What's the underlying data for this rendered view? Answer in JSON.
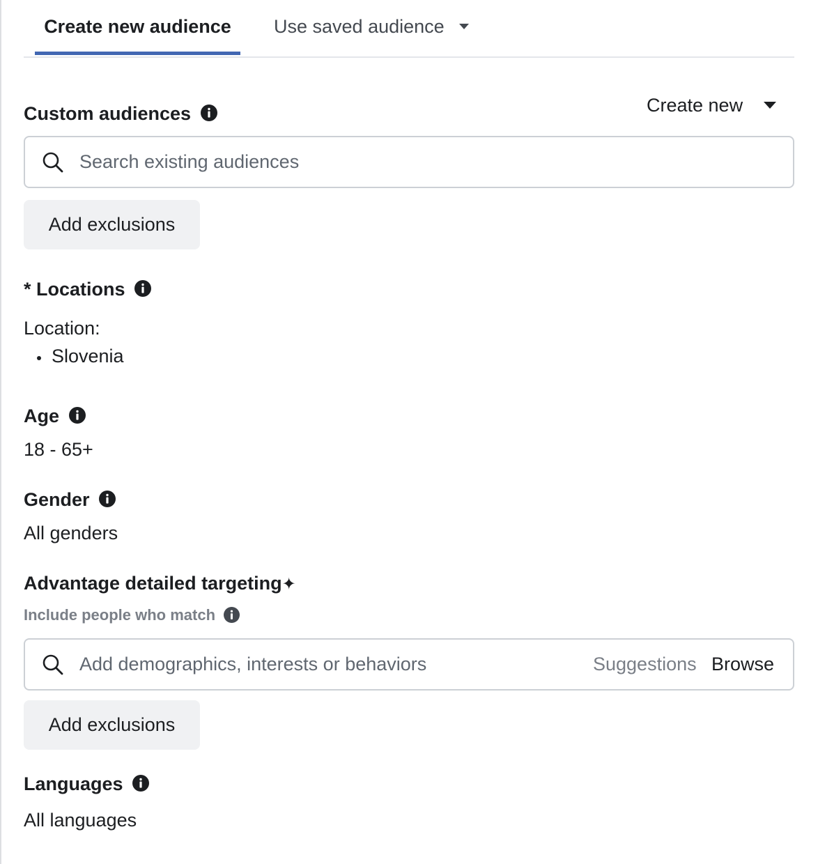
{
  "tabs": {
    "create_new": "Create new audience",
    "use_saved": "Use saved audience"
  },
  "custom_audiences": {
    "title": "Custom audiences",
    "create_new_label": "Create new",
    "search_placeholder": "Search existing audiences",
    "add_exclusions_label": "Add exclusions"
  },
  "locations": {
    "required_mark": "*",
    "title": "Locations",
    "label": "Location:",
    "items": [
      "Slovenia"
    ]
  },
  "age": {
    "title": "Age",
    "value": "18 - 65+"
  },
  "gender": {
    "title": "Gender",
    "value": "All genders"
  },
  "detailed_targeting": {
    "title": "Advantage detailed targeting",
    "sparkle": "✦",
    "include_label": "Include people who match",
    "search_placeholder": "Add demographics, interests or behaviors",
    "suggestions_label": "Suggestions",
    "browse_label": "Browse",
    "add_exclusions_label": "Add exclusions"
  },
  "languages": {
    "title": "Languages",
    "value": "All languages"
  },
  "colors": {
    "accent": "#4267b2",
    "text": "#1c1e21",
    "muted": "#606770",
    "button_bg": "#f0f1f3",
    "border": "#ccd0d5"
  },
  "icons": {
    "info": "info-icon",
    "search": "search-icon",
    "caret": "caret-down-icon",
    "sparkle": "sparkle-icon"
  }
}
